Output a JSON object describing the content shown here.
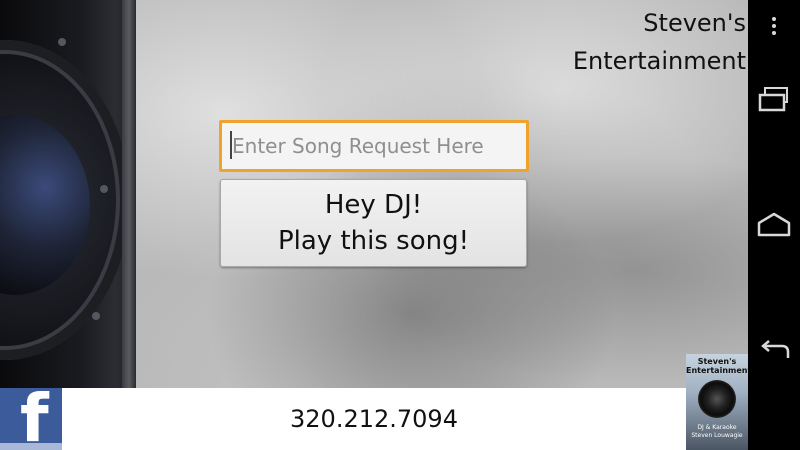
{
  "app": {
    "title_line1": "Steven's",
    "title_line2": "Entertainment"
  },
  "song_request": {
    "placeholder": "Enter Song Request Here",
    "value": ""
  },
  "request_button": {
    "line1": "Hey DJ!",
    "line2": "Play this song!"
  },
  "bottom_bar": {
    "facebook_icon": "facebook-icon",
    "phone_number": "320.212.7094",
    "logo": {
      "name": "Steven's Entertainment",
      "tagline_line1": "DJ & Karaoke",
      "tagline_line2": "Steven Louwagie"
    }
  },
  "navigation": {
    "icons": [
      "overflow-menu-icon",
      "recent-apps-icon",
      "home-icon",
      "back-icon"
    ]
  },
  "colors": {
    "input_focus_border": "#f0a32c",
    "facebook_blue": "#3b5b9a"
  }
}
